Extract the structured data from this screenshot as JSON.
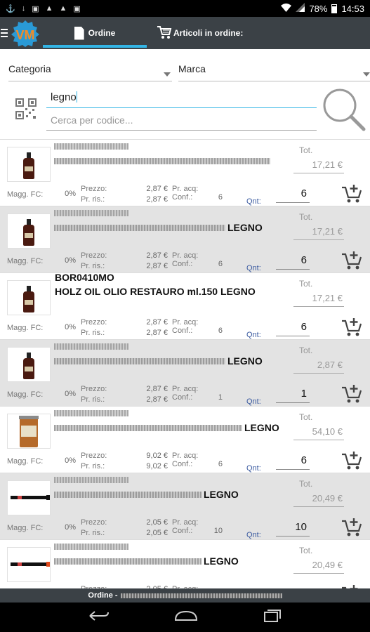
{
  "status_bar": {
    "battery": "78%",
    "time": "14:53"
  },
  "tabs": [
    {
      "label": "Ordine"
    },
    {
      "label": "Articoli in ordine:"
    }
  ],
  "filters": {
    "category_placeholder": "Categoria",
    "brand_placeholder": "Marca"
  },
  "search": {
    "value": "legno",
    "code_placeholder": "Cerca per codice..."
  },
  "labels": {
    "magg": "Magg. FC:",
    "prezzo": "Prezzo:",
    "pr_ris": "Pr. ris.:",
    "pr_acq": "Pr. acq:",
    "conf": "Conf.:",
    "qnt": "Qnt:",
    "tot": "Tot."
  },
  "products": [
    {
      "title": "",
      "code": "",
      "desc": "",
      "magg_pct": "0%",
      "prezzo": "2,87 €",
      "pr_ris": "2,87 €",
      "conf": "6",
      "qnt": "6",
      "tot": "17,21 €",
      "image": "oil-bottle",
      "alt": false
    },
    {
      "title": "LEGNO",
      "code": "",
      "desc": "",
      "magg_pct": "0%",
      "prezzo": "2,87 €",
      "pr_ris": "2,87 €",
      "conf": "6",
      "qnt": "6",
      "tot": "17,21 €",
      "image": "oil-bottle",
      "alt": true
    },
    {
      "title": "",
      "code": "BOR0410MO",
      "desc": "HOLZ OIL OLIO RESTAURO ml.150 LEGNO",
      "magg_pct": "0%",
      "prezzo": "2,87 €",
      "pr_ris": "2,87 €",
      "conf": "6",
      "qnt": "6",
      "tot": "17,21 €",
      "image": "oil-bottle",
      "alt": false
    },
    {
      "title": "LEGNO",
      "code": "",
      "desc": "",
      "magg_pct": "0%",
      "prezzo": "2,87 €",
      "pr_ris": "2,87 €",
      "conf": "1",
      "qnt": "1",
      "tot": "2,87 €",
      "image": "oil-bottle",
      "alt": true
    },
    {
      "title": "LEGNO",
      "code": "",
      "desc": "",
      "magg_pct": "0%",
      "prezzo": "9,02 €",
      "pr_ris": "9,02 €",
      "conf": "6",
      "qnt": "6",
      "tot": "54,10 €",
      "image": "tin-can",
      "alt": false
    },
    {
      "title": "LEGNO",
      "code": "",
      "desc": "",
      "magg_pct": "0%",
      "prezzo": "2,05 €",
      "pr_ris": "2,05 €",
      "conf": "10",
      "qnt": "10",
      "tot": "20,49 €",
      "image": "marker-black",
      "alt": true
    },
    {
      "title": "LEGNO",
      "code": "",
      "desc": "",
      "magg_pct": "",
      "prezzo": "2,05 €",
      "pr_ris": "",
      "conf": "",
      "qnt": "",
      "tot": "20,49 €",
      "image": "marker-red",
      "alt": false
    }
  ],
  "footer": {
    "label": "Ordine -"
  },
  "colors": {
    "accent": "#33b5e5",
    "appbar": "#3b4146",
    "qnt_label": "#3a5aa0",
    "logo_orange": "#f28c28",
    "logo_blue": "#2a9ad6"
  }
}
